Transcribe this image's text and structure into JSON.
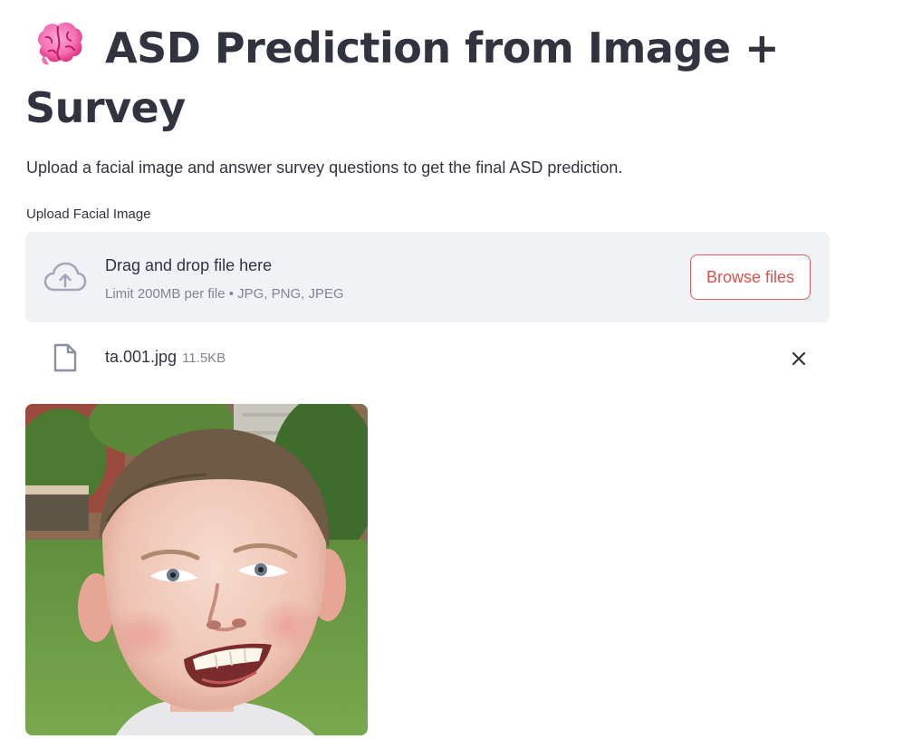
{
  "header": {
    "title_line1": "ASD Prediction from Image +",
    "title_line2": "Survey",
    "title_icon": "brain-emoji-icon",
    "subtitle": "Upload a facial image and answer survey questions to get the final ASD prediction."
  },
  "uploader": {
    "label": "Upload Facial Image",
    "dropzone_title": "Drag and drop file here",
    "dropzone_limit": "Limit 200MB per file • JPG, PNG, JPEG",
    "browse_label": "Browse files",
    "icon": "cloud-upload-icon"
  },
  "uploaded_file": {
    "name": "ta.001.jpg",
    "size": "11.5KB",
    "icon": "file-icon",
    "remove_icon": "close-icon"
  },
  "preview": {
    "alt": "Uploaded facial image preview"
  },
  "colors": {
    "text": "#31333f",
    "muted": "#808495",
    "dropzone_bg": "#f0f2f6",
    "accent": "#d9534f"
  }
}
